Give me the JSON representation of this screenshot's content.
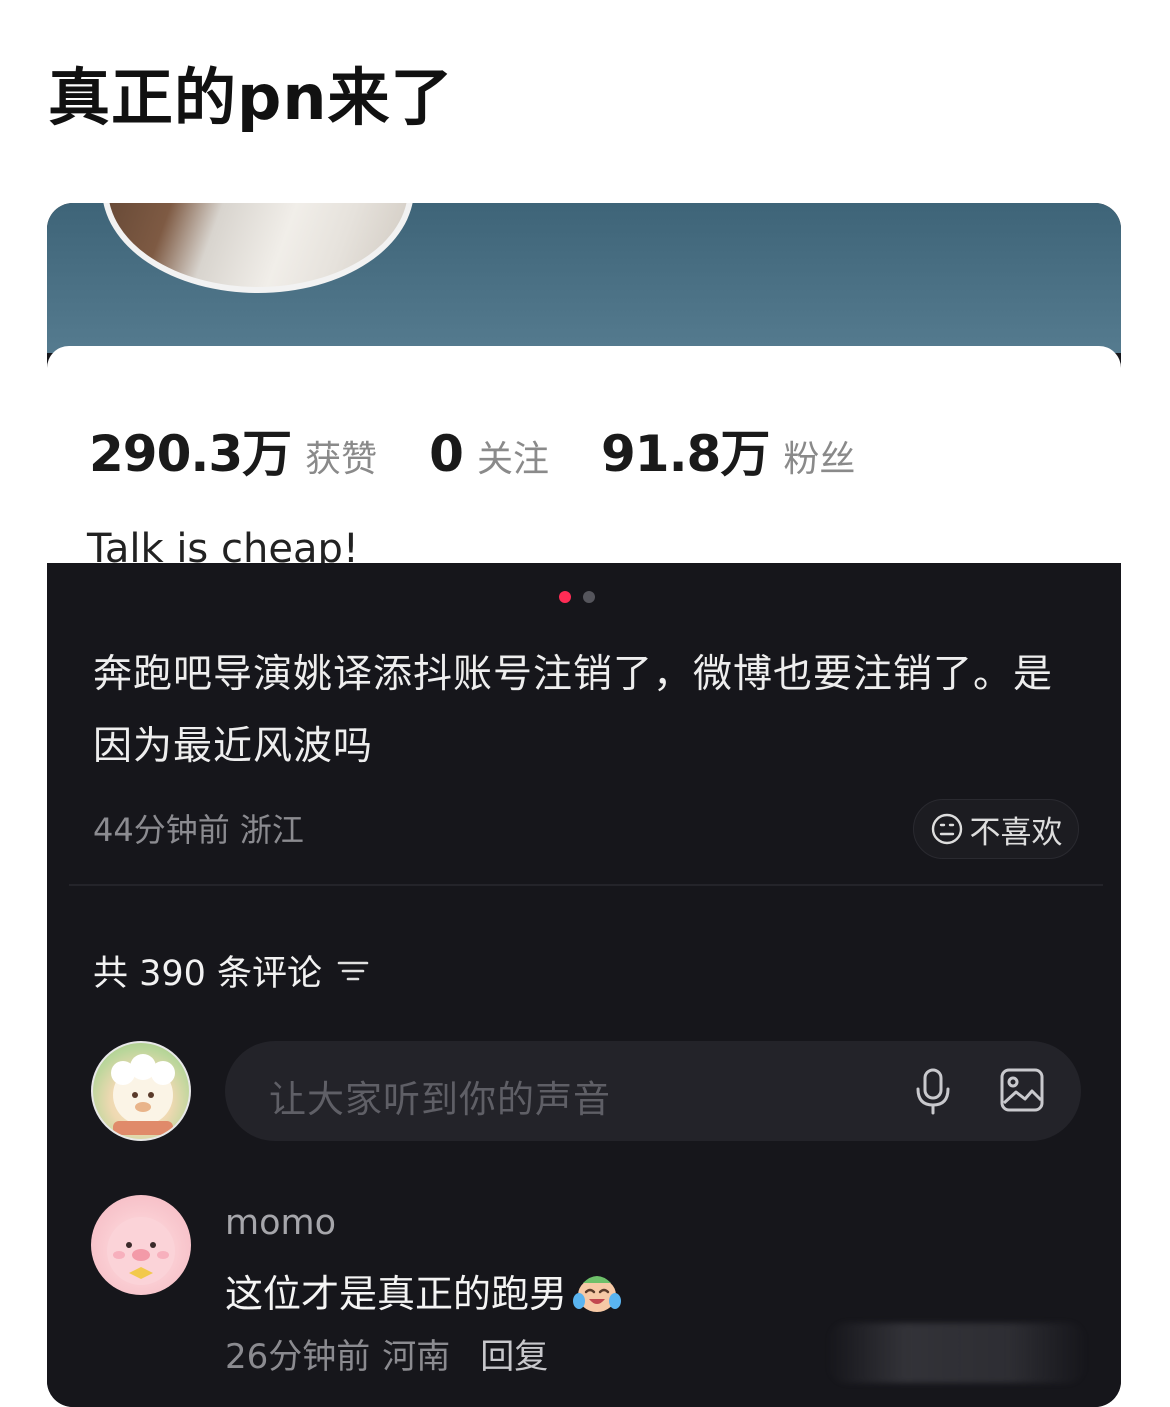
{
  "post": {
    "title": "真正的pn来了"
  },
  "profile": {
    "stats": [
      {
        "value": "290.3万",
        "label": "获赞"
      },
      {
        "value": "0",
        "label": "关注"
      },
      {
        "value": "91.8万",
        "label": "粉丝"
      }
    ],
    "bio": "Talk is cheap!"
  },
  "detail": {
    "description": "奔跑吧导演姚译添抖账号注销了，微博也要注销了。是因为最近风波吗",
    "time": "44分钟前",
    "location": "浙江",
    "dislike_label": "不喜欢"
  },
  "comments": {
    "count_label": "共 390 条评论",
    "input_placeholder": "让大家听到你的声音",
    "items": [
      {
        "user": "momo",
        "text": "这位才是真正的跑男",
        "time": "26分钟前",
        "location": "河南",
        "reply_label": "回复"
      }
    ]
  },
  "colors": {
    "accent": "#fe2c55",
    "dark_bg": "#16161b"
  }
}
